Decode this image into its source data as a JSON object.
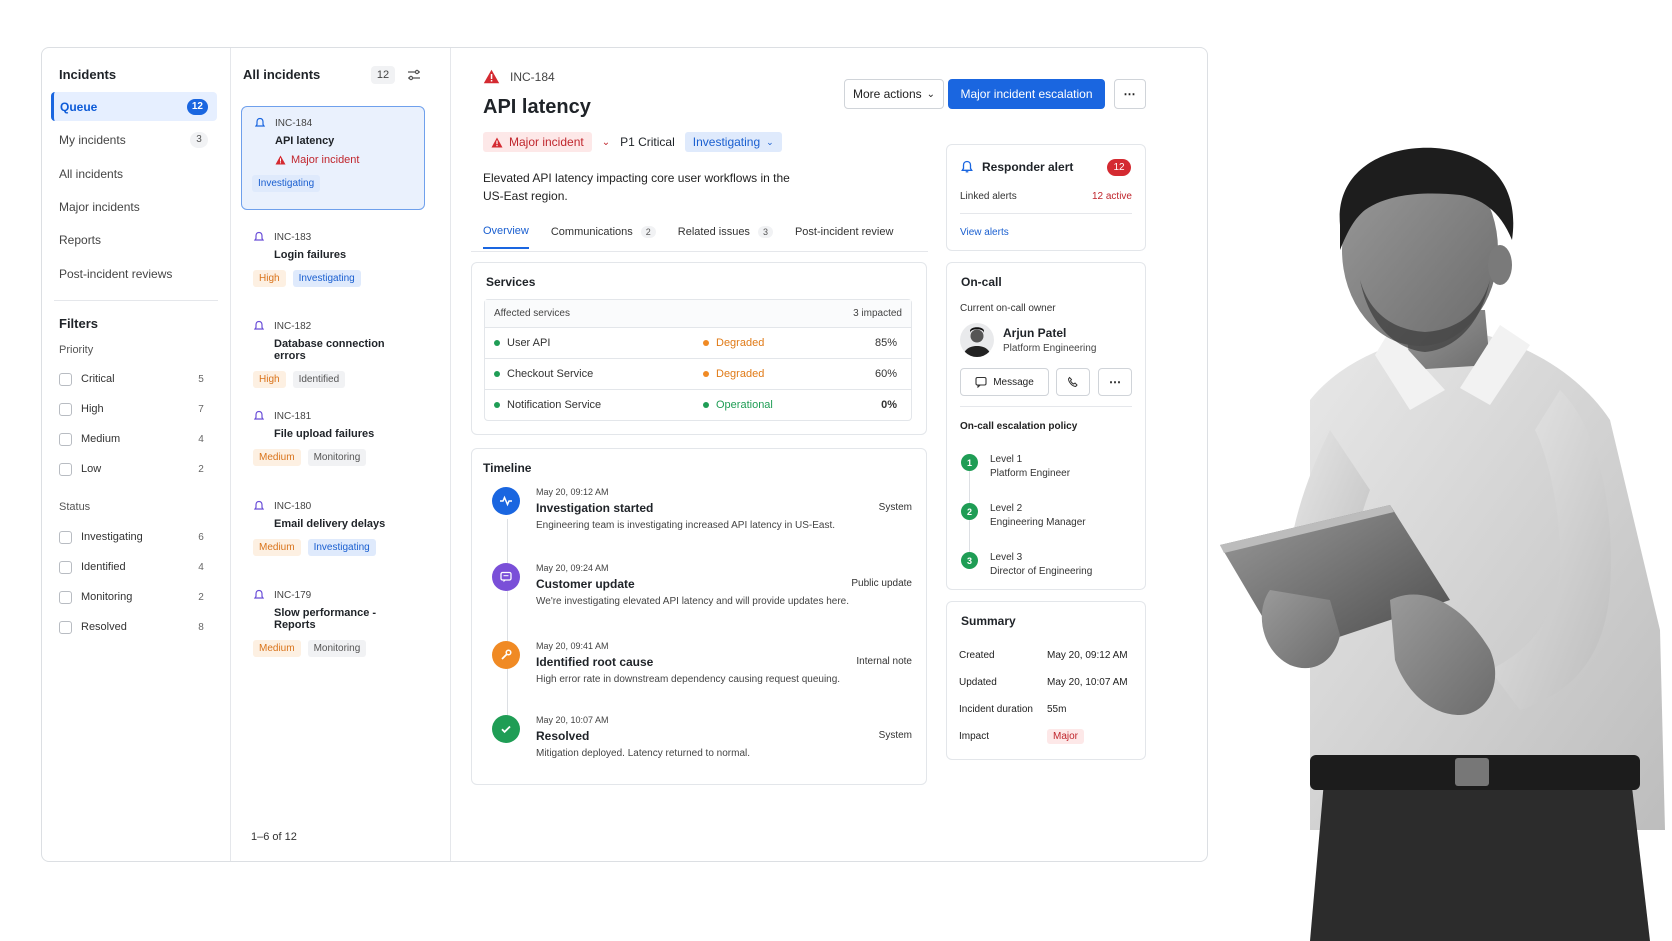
{
  "nav": {
    "title": "Incidents",
    "items": [
      {
        "label": "Queue",
        "count": "12"
      },
      {
        "label": "My incidents",
        "count": "3"
      },
      {
        "label": "All incidents",
        "count": ""
      },
      {
        "label": "Major incidents",
        "count": ""
      },
      {
        "label": "Reports",
        "count": ""
      },
      {
        "label": "Post-incident reviews",
        "count": ""
      }
    ],
    "filters_title": "Filters",
    "priority_title": "Priority",
    "priority": [
      {
        "label": "Critical",
        "count": "5"
      },
      {
        "label": "High",
        "count": "7"
      },
      {
        "label": "Medium",
        "count": "4"
      },
      {
        "label": "Low",
        "count": "2"
      }
    ],
    "status_title": "Status",
    "status": [
      {
        "label": "Investigating",
        "count": "6"
      },
      {
        "label": "Identified",
        "count": "4"
      },
      {
        "label": "Monitoring",
        "count": "2"
      },
      {
        "label": "Resolved",
        "count": "8"
      }
    ]
  },
  "list": {
    "title": "All incidents",
    "count": "12",
    "pager": "1–6 of 12",
    "incidents": [
      {
        "id": "INC-184",
        "title": "API latency",
        "major": "Major incident",
        "tags": [
          "Investigating"
        ]
      },
      {
        "id": "INC-183",
        "title": "Login failures",
        "tags": [
          "High",
          "Investigating"
        ]
      },
      {
        "id": "INC-182",
        "title": "Database connection errors",
        "tags": [
          "High",
          "Identified"
        ]
      },
      {
        "id": "INC-181",
        "title": "File upload failures",
        "tags": [
          "Medium",
          "Monitoring"
        ]
      },
      {
        "id": "INC-180",
        "title": "Email delivery delays",
        "tags": [
          "Medium",
          "Investigating"
        ]
      },
      {
        "id": "INC-179",
        "title": "Slow performance - Reports",
        "tags": [
          "Medium",
          "Monitoring"
        ]
      }
    ]
  },
  "detail": {
    "id": "INC-184",
    "title": "API latency",
    "major_badge": "Major incident",
    "priority": "P1 Critical",
    "status": "Investigating",
    "description": "Elevated API latency impacting core user workflows in the US-East region.",
    "more_actions": "More actions",
    "escalate": "Major incident escalation",
    "tabs": [
      {
        "label": "Overview",
        "count": ""
      },
      {
        "label": "Communications",
        "count": "2"
      },
      {
        "label": "Related issues",
        "count": "3"
      },
      {
        "label": "Post-incident review",
        "count": ""
      }
    ],
    "services": {
      "title": "Services",
      "header_left": "Affected services",
      "header_right": "3 impacted",
      "rows": [
        {
          "name": "User API",
          "status": "Degraded",
          "value": "85%"
        },
        {
          "name": "Checkout Service",
          "status": "Degraded",
          "value": "60%"
        },
        {
          "name": "Notification Service",
          "status": "Operational",
          "value": "0%"
        }
      ]
    },
    "timeline": {
      "title": "Timeline",
      "items": [
        {
          "date": "May 20, 09:12 AM",
          "title": "Investigation started",
          "text": "Engineering team is investigating increased API latency in US-East.",
          "source": "System"
        },
        {
          "date": "May 20, 09:24 AM",
          "title": "Customer update",
          "text": "We're investigating elevated API latency and will provide updates here.",
          "source": "Public update"
        },
        {
          "date": "May 20, 09:41 AM",
          "title": "Identified root cause",
          "text": "High error rate in downstream dependency causing request queuing.",
          "source": "Internal note"
        },
        {
          "date": "May 20, 10:07 AM",
          "title": "Resolved",
          "text": "Mitigation deployed. Latency returned to normal.",
          "source": "System"
        }
      ]
    }
  },
  "alert": {
    "title": "Responder alert",
    "count": "12",
    "linked_label": "Linked alerts",
    "linked_value": "12 active",
    "view": "View alerts"
  },
  "oncall": {
    "title": "On-call",
    "owner_label": "Current on-call owner",
    "name": "Arjun Patel",
    "team": "Platform Engineering",
    "message": "Message",
    "policy_title": "On-call escalation policy",
    "levels": [
      {
        "num": "1",
        "level": "Level 1",
        "role": "Platform Engineer"
      },
      {
        "num": "2",
        "level": "Level 2",
        "role": "Engineering Manager"
      },
      {
        "num": "3",
        "level": "Level 3",
        "role": "Director of Engineering"
      }
    ]
  },
  "summary": {
    "title": "Summary",
    "rows": [
      {
        "k": "Created",
        "v": "May 20, 09:12 AM"
      },
      {
        "k": "Updated",
        "v": "May 20, 10:07 AM"
      },
      {
        "k": "Incident duration",
        "v": "55m"
      },
      {
        "k": "Impact",
        "v": "Major"
      }
    ]
  },
  "colors": {
    "accent": "#1a66e0",
    "danger": "#c0262d",
    "warning": "#f08a24",
    "success": "#1f9d55"
  }
}
